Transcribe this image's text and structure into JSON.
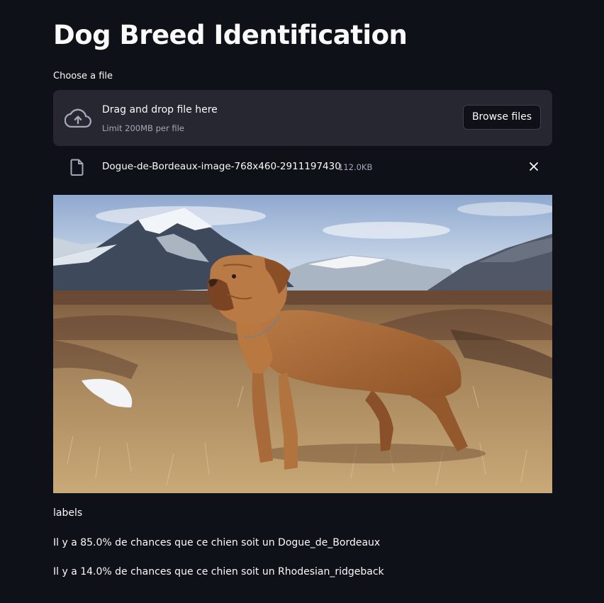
{
  "page": {
    "title": "Dog Breed Identification"
  },
  "uploader": {
    "label": "Choose a file",
    "dropzone_title": "Drag and drop file here",
    "dropzone_limit": "Limit 200MB per file",
    "browse_label": "Browse files",
    "icon": "cloud-upload-icon"
  },
  "uploaded_file": {
    "name": "Dogue-de-Bordeaux-image-768x460-2911197430",
    "size": "112.0KB",
    "icon": "file-icon",
    "remove_icon": "close-icon"
  },
  "results": {
    "header": "labels",
    "lines": [
      "Il y a 85.0% de chances que ce chien soit un Dogue_de_Bordeaux",
      "Il y a 14.0% de chances que ce chien soit un Rhodesian_ridgeback"
    ]
  },
  "colors": {
    "background": "#0e1117",
    "dropzone": "#262730",
    "text": "#fafafa",
    "muted_text": "#a3a8b8"
  }
}
